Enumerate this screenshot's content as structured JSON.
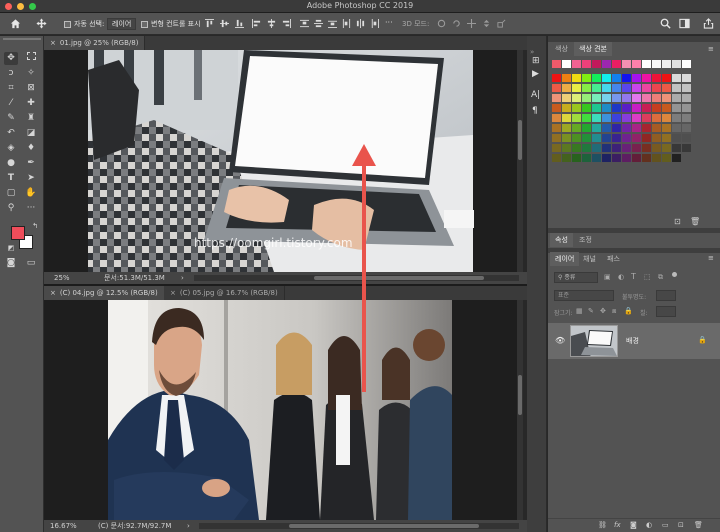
{
  "window": {
    "title": "Adobe Photoshop CC 2019",
    "traffic_colors": [
      "#fc605b",
      "#fdbc40",
      "#34c84a"
    ]
  },
  "options": {
    "auto_select_label": "자동 선택:",
    "auto_select_target": "레이어",
    "transform_controls_label": "변형 컨트롤 표시",
    "mode_label": "3D 모드:"
  },
  "doc1": {
    "tab_label": "01.jpg @ 25% (RGB/8)",
    "zoom": "25%",
    "doc_size": "문서:51.3M/51.3M",
    "watermark": "https://oomgirl.tistory.com"
  },
  "doc2": {
    "tab_label": "(C) 04.jpg @ 12.5% (RGB/8)",
    "zoom": "16.67%",
    "doc_size": "(C) 문서:92.7M/92.7M"
  },
  "doc3": {
    "tab_label": "(C) 05.jpg @ 16.7% (RGB/8)"
  },
  "swatches_panel": {
    "tabs": [
      "색상",
      "색상 견본"
    ],
    "active": "색상 견본"
  },
  "properties_panel": {
    "tabs": [
      "속성",
      "조정"
    ]
  },
  "layers_panel": {
    "tabs": [
      "레이어",
      "채널",
      "패스"
    ],
    "kind_label": "종류",
    "blend_mode": "표준",
    "opacity_label": "불투명도:",
    "lock_label": "잠그기:",
    "fill_label": "칠:",
    "layer_name": "배경"
  },
  "colors": {
    "foreground": "#ef4d5a",
    "background": "#ffffff",
    "arrow": "#e9544c"
  },
  "icons": [
    "home-icon",
    "move-icon",
    "search-icon",
    "workspace-icon",
    "share-icon",
    "eye-icon",
    "lock-icon"
  ]
}
